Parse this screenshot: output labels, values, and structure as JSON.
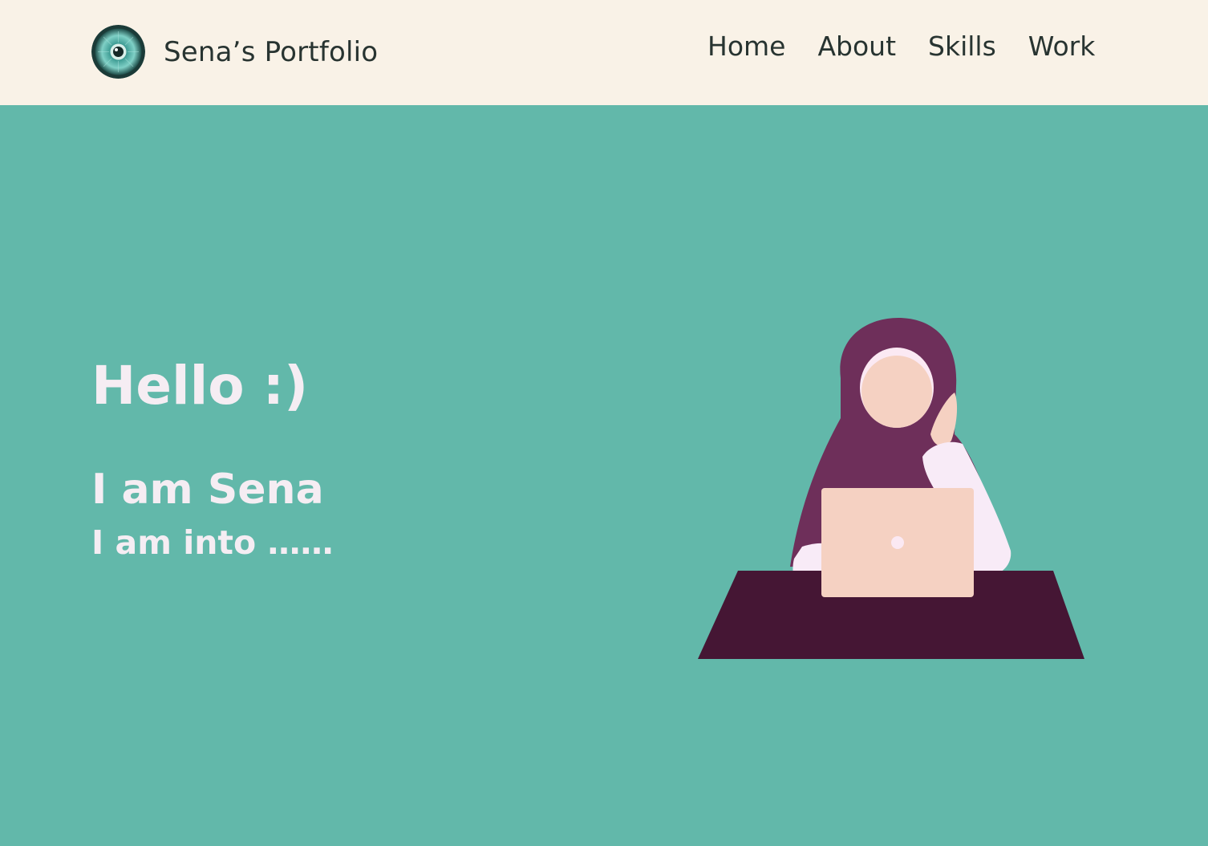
{
  "brand": {
    "name": "Sena’s Portfolio",
    "logo_icon": "eye-icon"
  },
  "nav": {
    "items": [
      {
        "label": "Home"
      },
      {
        "label": "About"
      },
      {
        "label": "Skills"
      },
      {
        "label": "Work"
      }
    ]
  },
  "hero": {
    "greeting": "Hello :)",
    "name_line": "I am Sena",
    "interest_line": "I am into ……",
    "illustration": "woman-with-laptop-illustration"
  },
  "colors": {
    "nav_background": "#f9f2e7",
    "hero_background": "#62b8aa",
    "text_dark": "#283431",
    "text_light": "#f5edf3",
    "hijab": "#6e2f5a",
    "desk": "#451634",
    "skin": "#f5d1c2",
    "laptop": "#f5d1c2",
    "sleeve": "#f8ebf7"
  }
}
